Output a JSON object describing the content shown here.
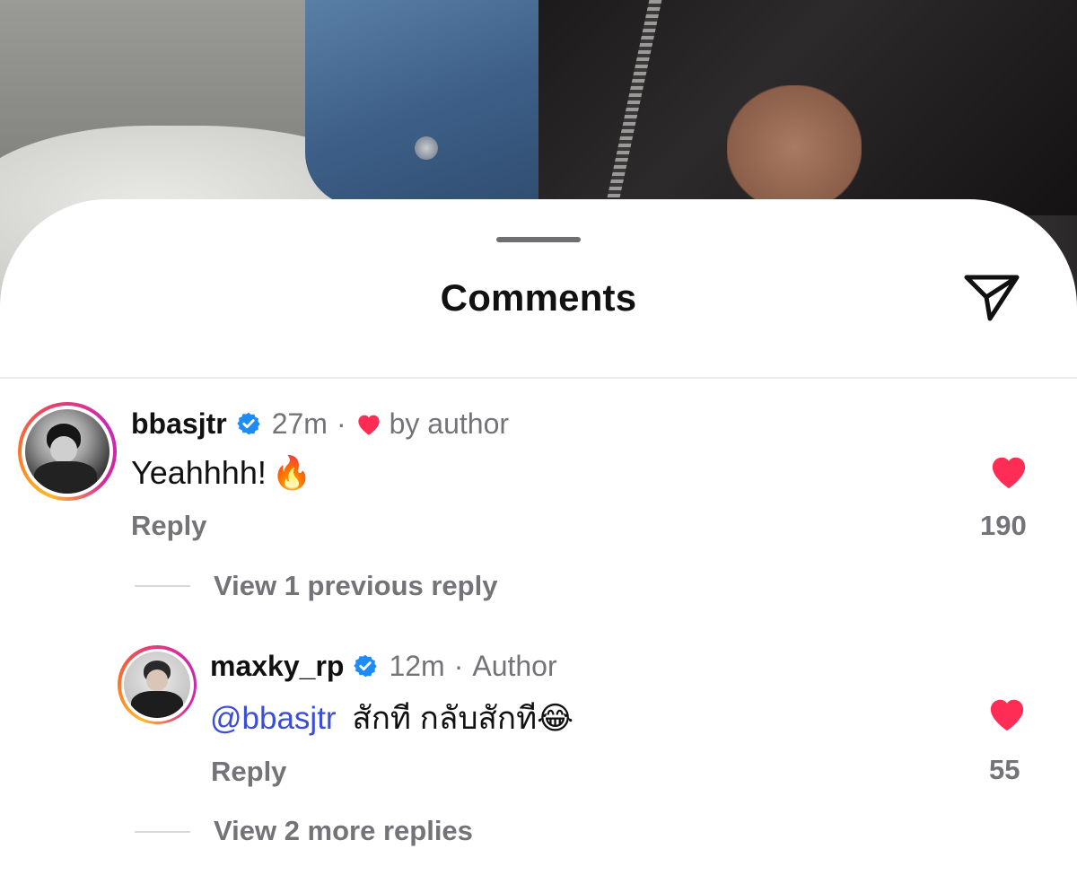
{
  "sheet": {
    "title": "Comments",
    "share_icon": "paper-plane-icon"
  },
  "colors": {
    "like": "#ff2d55",
    "verified": "#1d8cf8",
    "mention": "#3a4ed6",
    "secondary_text": "#737378"
  },
  "comments": [
    {
      "username": "bbasjtr",
      "verified": true,
      "time": "27m",
      "liked_by_author": "by author",
      "text": "Yeahhhh!",
      "emoji": "🔥",
      "reply_label": "Reply",
      "likes": "190",
      "view_replies": "View 1 previous reply"
    },
    {
      "username": "maxky_rp",
      "verified": true,
      "time": "12m",
      "role": "Author",
      "mention": "@bbasjtr",
      "text": "สักที กลับสักที",
      "emoji": "😂",
      "reply_label": "Reply",
      "likes": "55",
      "view_replies": "View 2 more replies"
    }
  ]
}
